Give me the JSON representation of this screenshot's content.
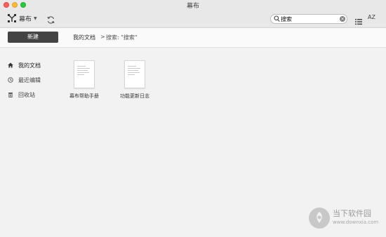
{
  "window": {
    "title": "幕布"
  },
  "toolbar": {
    "workspace_label": "幕布",
    "search": {
      "value": "搜索"
    },
    "sort_label": "AZ"
  },
  "action_bar": {
    "new_label": "新建",
    "breadcrumb": {
      "root": "我的文档",
      "separator": ">",
      "current": "搜索: \"搜索\""
    }
  },
  "sidebar": {
    "items": [
      {
        "label": "我的文档",
        "icon": "home-icon"
      },
      {
        "label": "最近编辑",
        "icon": "clock-icon"
      },
      {
        "label": "回收站",
        "icon": "trash-icon"
      }
    ]
  },
  "files": [
    {
      "name": "幕布帮助手册"
    },
    {
      "name": "功能更新日志"
    }
  ],
  "watermark": {
    "text": "当下软件园",
    "url": "www.downxia.com"
  }
}
